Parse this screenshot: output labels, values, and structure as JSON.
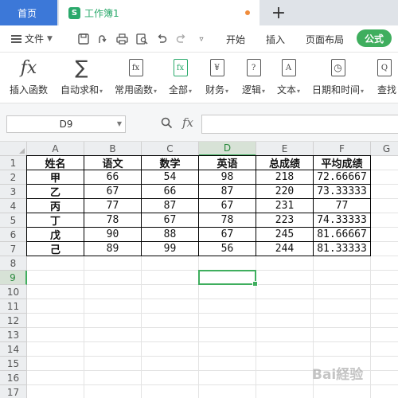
{
  "tabs": {
    "home": "首页",
    "doc": "工作簿1",
    "doc_icon": "S"
  },
  "menu": {
    "file": "文件",
    "items": [
      "开始",
      "插入",
      "页面布局",
      "公式"
    ],
    "active": "公式"
  },
  "ribbon": [
    {
      "label": "插入函数",
      "icon": "fx-icon",
      "dropdown": false
    },
    {
      "label": "自动求和",
      "icon": "sigma-icon",
      "dropdown": true
    },
    {
      "label": "常用函数",
      "icon": "fx-star-icon",
      "dropdown": true
    },
    {
      "label": "全部",
      "icon": "fx-box-icon",
      "dropdown": true
    },
    {
      "label": "财务",
      "icon": "yen-icon",
      "dropdown": true
    },
    {
      "label": "逻辑",
      "icon": "question-icon",
      "dropdown": true
    },
    {
      "label": "文本",
      "icon": "text-a-icon",
      "dropdown": true
    },
    {
      "label": "日期和时间",
      "icon": "clock-icon",
      "dropdown": true
    },
    {
      "label": "查找",
      "icon": "search-icon",
      "dropdown": false
    }
  ],
  "formula_bar": {
    "name_box": "D9",
    "fx_label": "fx",
    "value": ""
  },
  "sheet": {
    "columns": [
      "A",
      "B",
      "C",
      "D",
      "E",
      "F",
      "G"
    ],
    "rows": [
      "1",
      "2",
      "3",
      "4",
      "5",
      "6",
      "7",
      "8",
      "9",
      "10",
      "11",
      "12",
      "13",
      "14",
      "15",
      "16",
      "17"
    ],
    "selected_cell": "D9",
    "table": [
      [
        "姓名",
        "语文",
        "数学",
        "英语",
        "总成绩",
        "平均成绩"
      ],
      [
        "甲",
        "66",
        "54",
        "98",
        "218",
        "72.66667"
      ],
      [
        "乙",
        "67",
        "66",
        "87",
        "220",
        "73.33333"
      ],
      [
        "丙",
        "77",
        "87",
        "67",
        "231",
        "77"
      ],
      [
        "丁",
        "78",
        "67",
        "78",
        "223",
        "74.33333"
      ],
      [
        "戊",
        "90",
        "88",
        "67",
        "245",
        "81.66667"
      ],
      [
        "己",
        "89",
        "99",
        "56",
        "244",
        "81.33333"
      ]
    ]
  },
  "colors": {
    "accent_green": "#3fae5e",
    "tab_blue": "#3c78d8"
  },
  "watermark": "Bai経验"
}
